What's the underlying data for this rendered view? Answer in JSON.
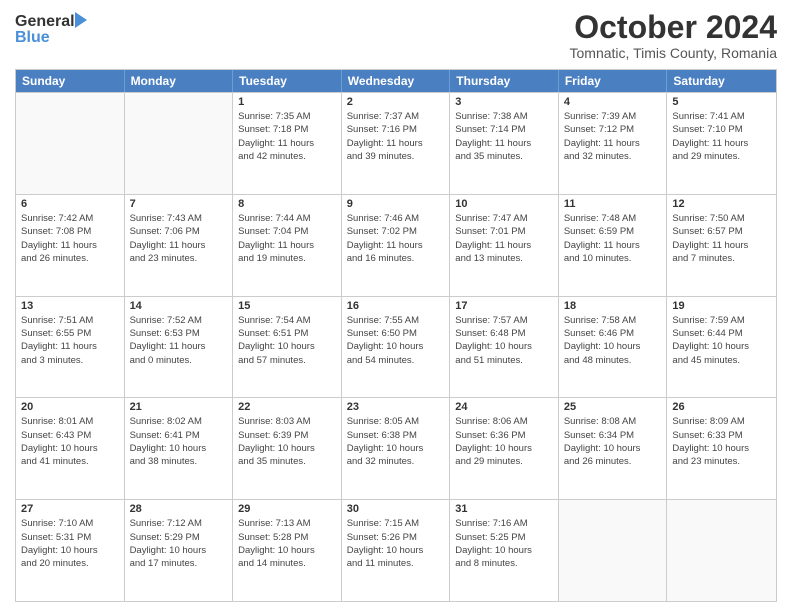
{
  "header": {
    "logo_general": "General",
    "logo_blue": "Blue",
    "month": "October 2024",
    "location": "Tomnatic, Timis County, Romania"
  },
  "days_of_week": [
    "Sunday",
    "Monday",
    "Tuesday",
    "Wednesday",
    "Thursday",
    "Friday",
    "Saturday"
  ],
  "weeks": [
    [
      {
        "day": "",
        "lines": []
      },
      {
        "day": "",
        "lines": []
      },
      {
        "day": "1",
        "lines": [
          "Sunrise: 7:35 AM",
          "Sunset: 7:18 PM",
          "Daylight: 11 hours",
          "and 42 minutes."
        ]
      },
      {
        "day": "2",
        "lines": [
          "Sunrise: 7:37 AM",
          "Sunset: 7:16 PM",
          "Daylight: 11 hours",
          "and 39 minutes."
        ]
      },
      {
        "day": "3",
        "lines": [
          "Sunrise: 7:38 AM",
          "Sunset: 7:14 PM",
          "Daylight: 11 hours",
          "and 35 minutes."
        ]
      },
      {
        "day": "4",
        "lines": [
          "Sunrise: 7:39 AM",
          "Sunset: 7:12 PM",
          "Daylight: 11 hours",
          "and 32 minutes."
        ]
      },
      {
        "day": "5",
        "lines": [
          "Sunrise: 7:41 AM",
          "Sunset: 7:10 PM",
          "Daylight: 11 hours",
          "and 29 minutes."
        ]
      }
    ],
    [
      {
        "day": "6",
        "lines": [
          "Sunrise: 7:42 AM",
          "Sunset: 7:08 PM",
          "Daylight: 11 hours",
          "and 26 minutes."
        ]
      },
      {
        "day": "7",
        "lines": [
          "Sunrise: 7:43 AM",
          "Sunset: 7:06 PM",
          "Daylight: 11 hours",
          "and 23 minutes."
        ]
      },
      {
        "day": "8",
        "lines": [
          "Sunrise: 7:44 AM",
          "Sunset: 7:04 PM",
          "Daylight: 11 hours",
          "and 19 minutes."
        ]
      },
      {
        "day": "9",
        "lines": [
          "Sunrise: 7:46 AM",
          "Sunset: 7:02 PM",
          "Daylight: 11 hours",
          "and 16 minutes."
        ]
      },
      {
        "day": "10",
        "lines": [
          "Sunrise: 7:47 AM",
          "Sunset: 7:01 PM",
          "Daylight: 11 hours",
          "and 13 minutes."
        ]
      },
      {
        "day": "11",
        "lines": [
          "Sunrise: 7:48 AM",
          "Sunset: 6:59 PM",
          "Daylight: 11 hours",
          "and 10 minutes."
        ]
      },
      {
        "day": "12",
        "lines": [
          "Sunrise: 7:50 AM",
          "Sunset: 6:57 PM",
          "Daylight: 11 hours",
          "and 7 minutes."
        ]
      }
    ],
    [
      {
        "day": "13",
        "lines": [
          "Sunrise: 7:51 AM",
          "Sunset: 6:55 PM",
          "Daylight: 11 hours",
          "and 3 minutes."
        ]
      },
      {
        "day": "14",
        "lines": [
          "Sunrise: 7:52 AM",
          "Sunset: 6:53 PM",
          "Daylight: 11 hours",
          "and 0 minutes."
        ]
      },
      {
        "day": "15",
        "lines": [
          "Sunrise: 7:54 AM",
          "Sunset: 6:51 PM",
          "Daylight: 10 hours",
          "and 57 minutes."
        ]
      },
      {
        "day": "16",
        "lines": [
          "Sunrise: 7:55 AM",
          "Sunset: 6:50 PM",
          "Daylight: 10 hours",
          "and 54 minutes."
        ]
      },
      {
        "day": "17",
        "lines": [
          "Sunrise: 7:57 AM",
          "Sunset: 6:48 PM",
          "Daylight: 10 hours",
          "and 51 minutes."
        ]
      },
      {
        "day": "18",
        "lines": [
          "Sunrise: 7:58 AM",
          "Sunset: 6:46 PM",
          "Daylight: 10 hours",
          "and 48 minutes."
        ]
      },
      {
        "day": "19",
        "lines": [
          "Sunrise: 7:59 AM",
          "Sunset: 6:44 PM",
          "Daylight: 10 hours",
          "and 45 minutes."
        ]
      }
    ],
    [
      {
        "day": "20",
        "lines": [
          "Sunrise: 8:01 AM",
          "Sunset: 6:43 PM",
          "Daylight: 10 hours",
          "and 41 minutes."
        ]
      },
      {
        "day": "21",
        "lines": [
          "Sunrise: 8:02 AM",
          "Sunset: 6:41 PM",
          "Daylight: 10 hours",
          "and 38 minutes."
        ]
      },
      {
        "day": "22",
        "lines": [
          "Sunrise: 8:03 AM",
          "Sunset: 6:39 PM",
          "Daylight: 10 hours",
          "and 35 minutes."
        ]
      },
      {
        "day": "23",
        "lines": [
          "Sunrise: 8:05 AM",
          "Sunset: 6:38 PM",
          "Daylight: 10 hours",
          "and 32 minutes."
        ]
      },
      {
        "day": "24",
        "lines": [
          "Sunrise: 8:06 AM",
          "Sunset: 6:36 PM",
          "Daylight: 10 hours",
          "and 29 minutes."
        ]
      },
      {
        "day": "25",
        "lines": [
          "Sunrise: 8:08 AM",
          "Sunset: 6:34 PM",
          "Daylight: 10 hours",
          "and 26 minutes."
        ]
      },
      {
        "day": "26",
        "lines": [
          "Sunrise: 8:09 AM",
          "Sunset: 6:33 PM",
          "Daylight: 10 hours",
          "and 23 minutes."
        ]
      }
    ],
    [
      {
        "day": "27",
        "lines": [
          "Sunrise: 7:10 AM",
          "Sunset: 5:31 PM",
          "Daylight: 10 hours",
          "and 20 minutes."
        ]
      },
      {
        "day": "28",
        "lines": [
          "Sunrise: 7:12 AM",
          "Sunset: 5:29 PM",
          "Daylight: 10 hours",
          "and 17 minutes."
        ]
      },
      {
        "day": "29",
        "lines": [
          "Sunrise: 7:13 AM",
          "Sunset: 5:28 PM",
          "Daylight: 10 hours",
          "and 14 minutes."
        ]
      },
      {
        "day": "30",
        "lines": [
          "Sunrise: 7:15 AM",
          "Sunset: 5:26 PM",
          "Daylight: 10 hours",
          "and 11 minutes."
        ]
      },
      {
        "day": "31",
        "lines": [
          "Sunrise: 7:16 AM",
          "Sunset: 5:25 PM",
          "Daylight: 10 hours",
          "and 8 minutes."
        ]
      },
      {
        "day": "",
        "lines": []
      },
      {
        "day": "",
        "lines": []
      }
    ]
  ]
}
